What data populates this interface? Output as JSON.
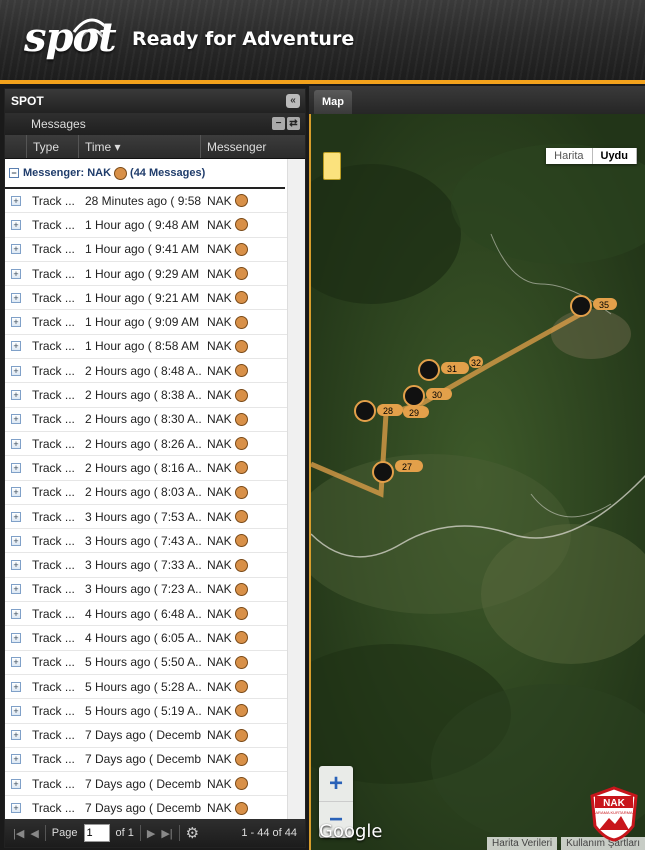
{
  "header": {
    "logo": "spot",
    "tagline": "Ready for Adventure"
  },
  "left_panel": {
    "title": "SPOT",
    "subtitle": "Messages",
    "columns": {
      "type": "Type",
      "time": "Time ▾",
      "messenger": "Messenger"
    },
    "group": {
      "label": "Messenger: NAK",
      "count": "(44 Messages)"
    },
    "rows": [
      {
        "type": "Track ...",
        "time": "28 Minutes ago ( 9:58...",
        "messenger": "NAK"
      },
      {
        "type": "Track ...",
        "time": "1 Hour ago ( 9:48 AM )",
        "messenger": "NAK"
      },
      {
        "type": "Track ...",
        "time": "1 Hour ago ( 9:41 AM )",
        "messenger": "NAK"
      },
      {
        "type": "Track ...",
        "time": "1 Hour ago ( 9:29 AM )",
        "messenger": "NAK"
      },
      {
        "type": "Track ...",
        "time": "1 Hour ago ( 9:21 AM )",
        "messenger": "NAK"
      },
      {
        "type": "Track ...",
        "time": "1 Hour ago ( 9:09 AM )",
        "messenger": "NAK"
      },
      {
        "type": "Track ...",
        "time": "1 Hour ago ( 8:58 AM )",
        "messenger": "NAK"
      },
      {
        "type": "Track ...",
        "time": "2 Hours ago ( 8:48 A...",
        "messenger": "NAK"
      },
      {
        "type": "Track ...",
        "time": "2 Hours ago ( 8:38 A...",
        "messenger": "NAK"
      },
      {
        "type": "Track ...",
        "time": "2 Hours ago ( 8:30 A...",
        "messenger": "NAK"
      },
      {
        "type": "Track ...",
        "time": "2 Hours ago ( 8:26 A...",
        "messenger": "NAK"
      },
      {
        "type": "Track ...",
        "time": "2 Hours ago ( 8:16 A...",
        "messenger": "NAK"
      },
      {
        "type": "Track ...",
        "time": "2 Hours ago ( 8:03 A...",
        "messenger": "NAK"
      },
      {
        "type": "Track ...",
        "time": "3 Hours ago ( 7:53 A...",
        "messenger": "NAK"
      },
      {
        "type": "Track ...",
        "time": "3 Hours ago ( 7:43 A...",
        "messenger": "NAK"
      },
      {
        "type": "Track ...",
        "time": "3 Hours ago ( 7:33 A...",
        "messenger": "NAK"
      },
      {
        "type": "Track ...",
        "time": "3 Hours ago ( 7:23 A...",
        "messenger": "NAK"
      },
      {
        "type": "Track ...",
        "time": "4 Hours ago ( 6:48 A...",
        "messenger": "NAK"
      },
      {
        "type": "Track ...",
        "time": "4 Hours ago ( 6:05 A...",
        "messenger": "NAK"
      },
      {
        "type": "Track ...",
        "time": "5 Hours ago ( 5:50 A...",
        "messenger": "NAK"
      },
      {
        "type": "Track ...",
        "time": "5 Hours ago ( 5:28 A...",
        "messenger": "NAK"
      },
      {
        "type": "Track ...",
        "time": "5 Hours ago ( 5:19 A...",
        "messenger": "NAK"
      },
      {
        "type": "Track ...",
        "time": "7 Days ago ( Decemb...",
        "messenger": "NAK"
      },
      {
        "type": "Track ...",
        "time": "7 Days ago ( Decemb...",
        "messenger": "NAK"
      },
      {
        "type": "Track ...",
        "time": "7 Days ago ( Decemb...",
        "messenger": "NAK"
      },
      {
        "type": "Track ...",
        "time": "7 Days ago ( Decemb...",
        "messenger": "NAK"
      }
    ],
    "pager": {
      "page_label": "Page",
      "page_value": "1",
      "of_label": "of 1",
      "info": "1 - 44 of 44"
    }
  },
  "map": {
    "tab": "Map",
    "map_types": [
      "Harita",
      "Uydu"
    ],
    "active_type": "Uydu",
    "zoom_in": "+",
    "zoom_out": "−",
    "google": "Google",
    "attribution": [
      "Harita Verileri",
      "Kullanım Şartları"
    ],
    "markers": [
      "27",
      "28",
      "29",
      "30",
      "31",
      "32",
      "35"
    ],
    "logo_text": "NAK",
    "logo_subtext": "ARAMA KURTARMA"
  },
  "colors": {
    "accent": "#f3a21c",
    "track": "#d89048",
    "group_text": "#1f3c6b"
  }
}
